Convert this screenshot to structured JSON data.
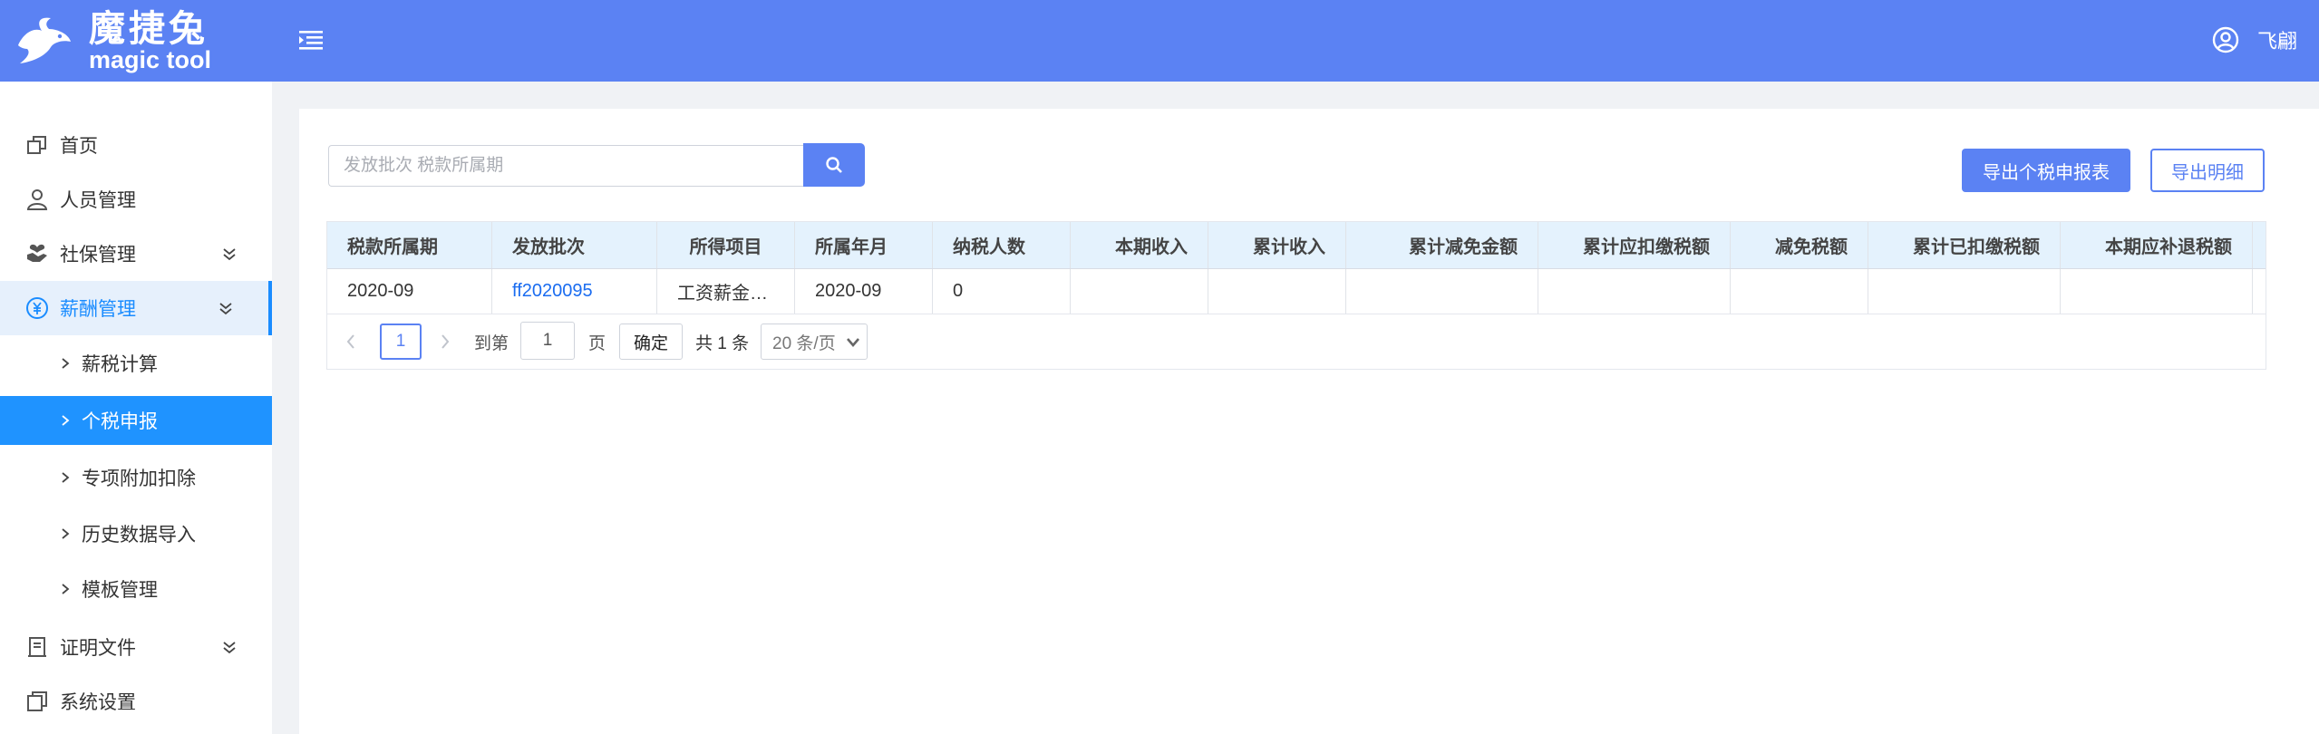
{
  "header": {
    "logo_cn": "魔捷兔",
    "logo_en": "magic tool",
    "user_name": "飞翩"
  },
  "sidebar": {
    "items": [
      {
        "label": "首页",
        "icon": "home-icon"
      },
      {
        "label": "人员管理",
        "icon": "user-icon"
      },
      {
        "label": "社保管理",
        "icon": "handheart-icon"
      },
      {
        "label": "薪酬管理",
        "icon": "yen-icon"
      },
      {
        "label": "证明文件",
        "icon": "stamp-icon"
      },
      {
        "label": "系统设置",
        "icon": "settings-icon"
      }
    ],
    "sub_items": [
      {
        "label": "薪税计算"
      },
      {
        "label": "个税申报"
      },
      {
        "label": "专项附加扣除"
      },
      {
        "label": "历史数据导入"
      },
      {
        "label": "模板管理"
      }
    ]
  },
  "toolbar": {
    "search_placeholder": "发放批次 税款所属期",
    "export_report_label": "导出个税申报表",
    "export_detail_label": "导出明细"
  },
  "table": {
    "columns": [
      "税款所属期",
      "发放批次",
      "所得项目",
      "所属年月",
      "纳税人数",
      "本期收入",
      "累计收入",
      "累计减免金额",
      "累计应扣缴税额",
      "减免税额",
      "累计已扣缴税额",
      "本期应补退税额"
    ],
    "rows": [
      [
        "2020-09",
        "ff2020095",
        "工资薪金…",
        "2020-09",
        "0",
        "",
        "",
        "",
        "",
        "",
        "",
        ""
      ]
    ]
  },
  "pagination": {
    "current_page": "1",
    "goto_label": "到第",
    "goto_value": "1",
    "page_unit": "页",
    "confirm_label": "确定",
    "total_text": "共 1 条",
    "page_size": "20 条/页"
  },
  "colors": {
    "brand": "#5b82f3",
    "active_menu": "#1f93ff",
    "link": "#1a6cf0"
  }
}
